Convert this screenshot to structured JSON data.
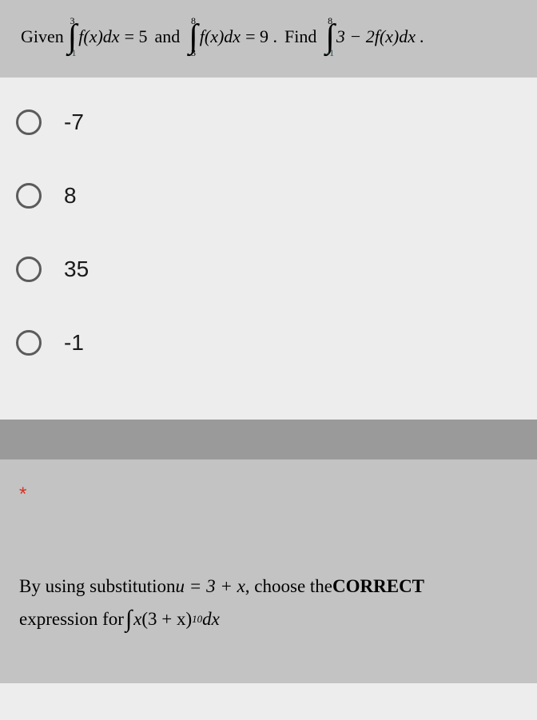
{
  "question1": {
    "given_word": "Given",
    "and_word": "and",
    "find_word": "Find",
    "integral1": {
      "upper": "3",
      "lower": "-1",
      "integrand": "f(x)dx",
      "equals": "= 5"
    },
    "integral2": {
      "upper": "8",
      "lower": "3",
      "integrand": "f(x)dx",
      "equals": "= 9 ."
    },
    "integral3": {
      "upper": "8",
      "lower": "-1",
      "integrand": "3 − 2f(x)dx ."
    },
    "options": [
      "-7",
      "8",
      "35",
      "-1"
    ]
  },
  "question2": {
    "required": "*",
    "line1_part1": "By using substitution ",
    "line1_sub": "u = 3 + x",
    "line1_part2": " , choose the ",
    "line1_bold": "CORRECT",
    "line2_part1": "expression for ",
    "line2_integrand_x": "x",
    "line2_integrand_paren": "(3 + x)",
    "line2_exp": "10",
    "line2_dx": " dx"
  }
}
